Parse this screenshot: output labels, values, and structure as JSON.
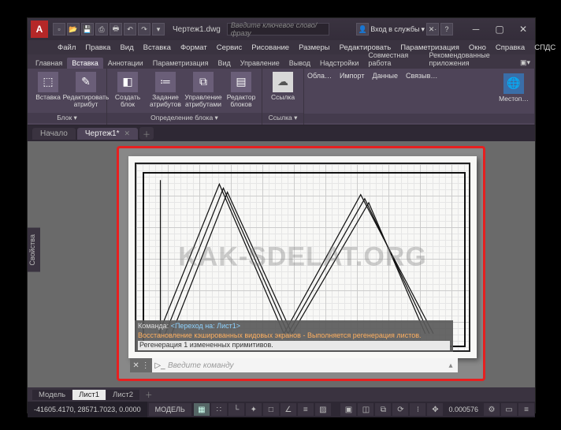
{
  "app": {
    "logo": "A",
    "title": "Чертеж1.dwg"
  },
  "search": {
    "placeholder": "Введите ключевое слово/фразу"
  },
  "login": {
    "label": "Вход в службы"
  },
  "menu": [
    "Файл",
    "Правка",
    "Вид",
    "Вставка",
    "Формат",
    "Сервис",
    "Рисование",
    "Размеры",
    "Редактировать",
    "Параметризация",
    "Окно",
    "Справка",
    "СПДС"
  ],
  "ribbon_tabs": [
    "Главная",
    "Вставка",
    "Аннотации",
    "Параметризация",
    "Вид",
    "Управление",
    "Вывод",
    "Надстройки",
    "Совместная работа",
    "Рекомендованные приложения"
  ],
  "ribbon_active": 1,
  "ribbon": {
    "panel1": {
      "title": "Блок ▾",
      "btns": [
        {
          "label": "Вставка",
          "icon": "⬚"
        },
        {
          "label": "Редактировать атрибут",
          "icon": "✎"
        }
      ]
    },
    "panel2": {
      "title": "Определение блока ▾",
      "btns": [
        {
          "label": "Создать блок",
          "icon": "◧"
        },
        {
          "label": "Задание атрибутов",
          "icon": "≔"
        },
        {
          "label": "Управление атрибутами",
          "icon": "⧉"
        },
        {
          "label": "Редактор блоков",
          "icon": "▤"
        }
      ]
    },
    "panel3": {
      "title": "Ссылка ▾",
      "btns": [
        {
          "label": "Ссылка",
          "icon": "☁"
        }
      ]
    },
    "trail": [
      "Обла…",
      "Импорт",
      "Данные",
      "Связыв…"
    ],
    "last": {
      "label": "Местоп…",
      "icon": "🌐"
    }
  },
  "doctabs": {
    "items": [
      "Начало",
      "Чертеж1*"
    ],
    "active": 1
  },
  "side_panel": "Свойства",
  "watermark": "KAK-SDELAT.ORG",
  "cmd": {
    "l1a": "Команда:",
    "l1b": "<Переход на: Лист1>",
    "l2": "Восстановление кэшированных видовых экранов - Выполняется регенерация листов.",
    "l3": "Регенерация 1 измененных примитивов.",
    "prompt": "Введите команду"
  },
  "layout_tabs": {
    "items": [
      "Модель",
      "Лист1",
      "Лист2"
    ],
    "active": 1
  },
  "status": {
    "coords": "-41605.4170, 28571.7023, 0.0000",
    "model": "МОДЕЛЬ",
    "scale": "0.000576"
  }
}
